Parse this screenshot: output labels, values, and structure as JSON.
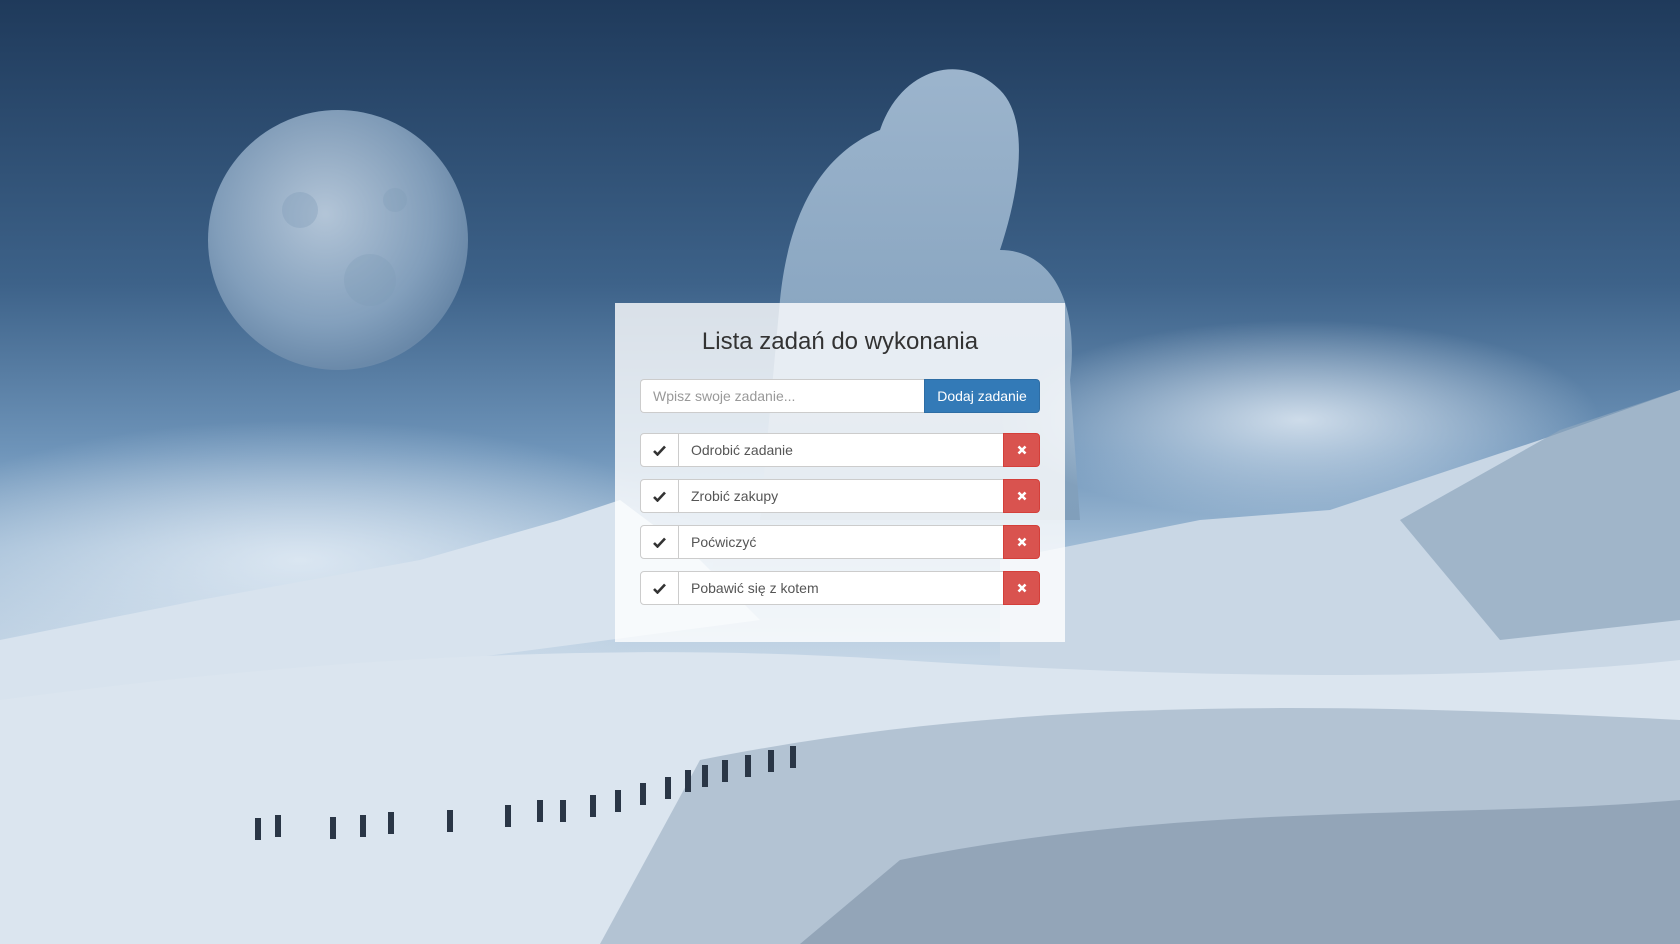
{
  "colors": {
    "primary_button": "#337ab7",
    "danger_button": "#d9534f",
    "panel_background": "rgba(255,255,255,0.8)",
    "title_text": "#333333"
  },
  "background": {
    "scene": "snowy-landscape-with-moon-statue-and-hikers"
  },
  "app": {
    "title": "Lista zadań do wykonania"
  },
  "add_form": {
    "input_placeholder": "Wpisz swoje zadanie...",
    "input_value": "",
    "button_label": "Dodaj zadanie"
  },
  "tasks": [
    {
      "label": "Odrobić zadanie",
      "check_icon": "check-icon",
      "delete_icon": "close-icon"
    },
    {
      "label": "Zrobić zakupy",
      "check_icon": "check-icon",
      "delete_icon": "close-icon"
    },
    {
      "label": "Poćwiczyć",
      "check_icon": "check-icon",
      "delete_icon": "close-icon"
    },
    {
      "label": "Pobawić się z kotem",
      "check_icon": "check-icon",
      "delete_icon": "close-icon"
    }
  ]
}
